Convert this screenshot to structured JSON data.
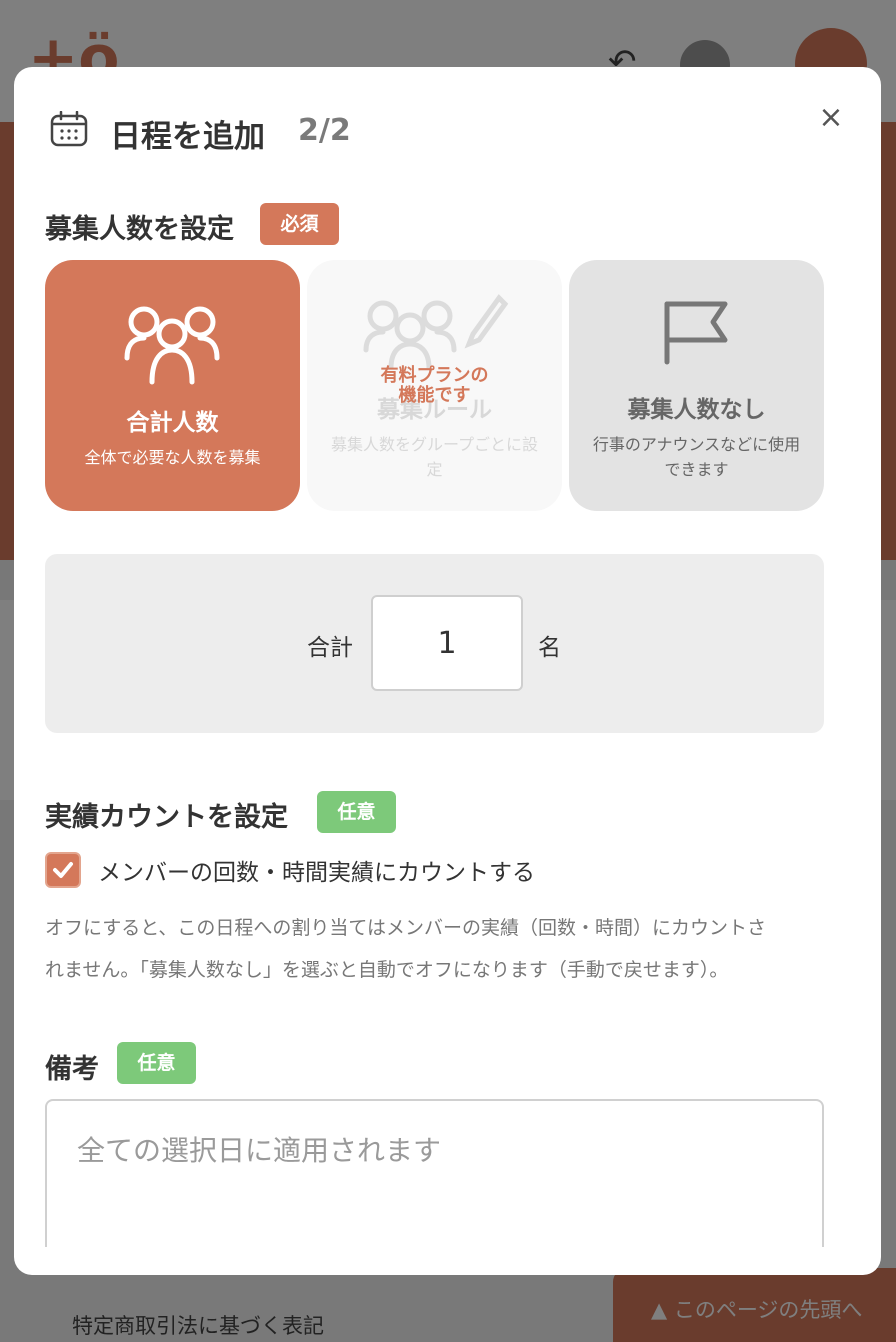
{
  "background": {
    "logo_text": "+ö",
    "footer_link": "特定商取引法に基づく表記",
    "page_top": "▲ このページの先頭へ"
  },
  "modal": {
    "title": "日程を追加",
    "step": "2/2",
    "close_label": "×",
    "recruit": {
      "title": "募集人数を設定",
      "badge": "必須",
      "options": [
        {
          "label": "合計人数",
          "desc": "全体で必要な人数を募集",
          "selected": true,
          "icon": "group-icon"
        },
        {
          "label": "募集ルール",
          "desc": "募集人数をグループごとに設定",
          "paid_note_line1": "有料プランの",
          "paid_note_line2": "機能です",
          "disabled": true,
          "icon": "group-edit-icon"
        },
        {
          "label": "募集人数なし",
          "desc": "行事のアナウンスなどに使用できます",
          "selected": false,
          "icon": "flag-icon"
        }
      ],
      "total_prefix": "合計",
      "total_value": "1",
      "total_suffix": "名"
    },
    "count": {
      "title": "実績カウントを設定",
      "badge": "任意",
      "checkbox_label": "メンバーの回数・時間実績にカウントする",
      "checked": true,
      "help_line1": "オフにすると、この日程への割り当てはメンバーの実績（回数・時間）にカウントさ",
      "help_line2": "れません。「募集人数なし」を選ぶと自動でオフになります（手動で戻せます）。"
    },
    "note": {
      "title": "備考",
      "badge": "任意",
      "placeholder": "全ての選択日に適用されます"
    }
  },
  "colors": {
    "accent": "#d4785a",
    "optional_badge": "#7dc97a"
  }
}
